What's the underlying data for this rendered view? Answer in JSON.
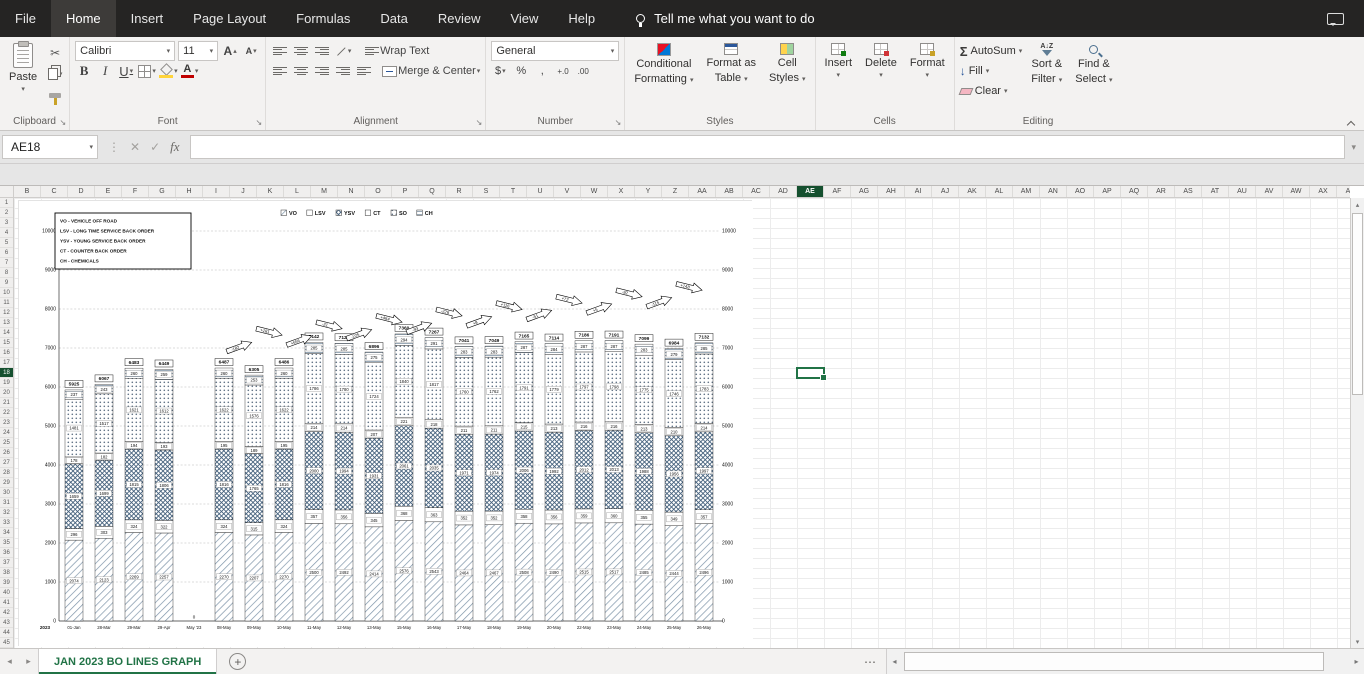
{
  "colors": {
    "excel_green": "#217346",
    "titlebar_bg": "#252423",
    "ribbon_bg": "#f3f2f1",
    "selection_border": "#217346",
    "selected_header_bg": "#15502f"
  },
  "titlebar": {
    "tabs": [
      "File",
      "Home",
      "Insert",
      "Page Layout",
      "Formulas",
      "Data",
      "Review",
      "View",
      "Help"
    ],
    "active_tab": "Home",
    "tellme": "Tell me what you want to do"
  },
  "ribbon": {
    "clipboard": {
      "paste": "Paste",
      "label": "Clipboard"
    },
    "font": {
      "name": "Calibri",
      "size": "11",
      "bold": "B",
      "italic": "I",
      "underline": "U",
      "label": "Font"
    },
    "alignment": {
      "wrap_text": "Wrap Text",
      "merge_center": "Merge & Center",
      "label": "Alignment"
    },
    "number": {
      "format": "General",
      "currency": "$",
      "percent": "%",
      "comma": ",",
      "inc_decimal": "+.0",
      "dec_decimal": ".00",
      "label": "Number"
    },
    "styles": {
      "conditional_1": "Conditional",
      "conditional_2": "Formatting",
      "format_table_1": "Format as",
      "format_table_2": "Table",
      "cell_styles_1": "Cell",
      "cell_styles_2": "Styles",
      "label": "Styles"
    },
    "cells": {
      "insert": "Insert",
      "del": "Delete",
      "format": "Format",
      "label": "Cells"
    },
    "editing": {
      "autosum": "AutoSum",
      "fill": "Fill",
      "clear": "Clear",
      "sort_1": "Sort &",
      "sort_2": "Filter",
      "find_1": "Find &",
      "find_2": "Select",
      "label": "Editing"
    }
  },
  "formula_bar": {
    "name_box": "AE18",
    "fx_label": "fx",
    "value": ""
  },
  "grid": {
    "columns": [
      "B",
      "C",
      "D",
      "E",
      "F",
      "G",
      "H",
      "I",
      "J",
      "K",
      "L",
      "M",
      "N",
      "O",
      "P",
      "Q",
      "R",
      "S",
      "T",
      "U",
      "V",
      "W",
      "X",
      "Y",
      "Z",
      "AA",
      "AB",
      "AC",
      "AD",
      "AE",
      "AF",
      "AG",
      "AH",
      "AI",
      "AJ",
      "AK",
      "AL",
      "AM",
      "AN",
      "AO",
      "AP",
      "AQ",
      "AR",
      "AS",
      "AT",
      "AU",
      "AV",
      "AW",
      "AX",
      "AY"
    ],
    "rows": 45,
    "selected": {
      "ref": "AE18",
      "col": "AE",
      "row": 18
    }
  },
  "sheet_tabs": {
    "active": "JAN 2023 BO LINES GRAPH"
  },
  "chart_data": {
    "type": "bar",
    "stacked": true,
    "legend": [
      "VO",
      "LSV",
      "YSV",
      "CT",
      "SO",
      "CH"
    ],
    "legend_position": "top",
    "key_box_lines": [
      "VO - VEHICLE OFF ROAD",
      "LSV - LONG TIME SERVICE BACK ORDER",
      "YSV - YOUNG SERVICE BACK ORDER",
      "CT - COUNTER BACK ORDER",
      "CH - CHEMICALS"
    ],
    "year_label": "2023",
    "categories": [
      "01-Jan",
      "28-Mar",
      "29-Mar",
      "29-Apr",
      "May '23",
      "08-May",
      "09-May",
      "10-May",
      "11-May",
      "12-May",
      "13-May",
      "15-May",
      "16-May",
      "17-May",
      "18-May",
      "19-May",
      "20-May",
      "22-May",
      "23-May",
      "24-May",
      "25-May",
      "26-May"
    ],
    "series": [
      {
        "name": "VO",
        "pattern": "diagonal",
        "values": [
          2074,
          2123,
          2269,
          2257,
          0,
          2270,
          2207,
          2270,
          2500,
          2492,
          2414,
          2576,
          2543,
          2464,
          2467,
          2508,
          2490,
          2515,
          2517,
          2485,
          2444,
          2496
        ]
      },
      {
        "name": "LSV",
        "pattern": "plain",
        "values": [
          296,
          303,
          324,
          322,
          0,
          324,
          315,
          324,
          357,
          356,
          345,
          368,
          363,
          352,
          352,
          358,
          356,
          359,
          360,
          355,
          349,
          357
        ]
      },
      {
        "name": "YSV",
        "pattern": "crosshatch",
        "values": [
          1659,
          1699,
          1815,
          1806,
          0,
          1816,
          1765,
          1816,
          2000,
          1994,
          1931,
          2061,
          2035,
          1971,
          1974,
          2006,
          1992,
          2012,
          2013,
          1988,
          1956,
          1997
        ]
      },
      {
        "name": "CT",
        "pattern": "plain",
        "values": [
          178,
          182,
          194,
          193,
          0,
          195,
          189,
          195,
          214,
          214,
          207,
          221,
          218,
          211,
          211,
          215,
          213,
          216,
          216,
          213,
          210,
          214
        ]
      },
      {
        "name": "SO",
        "pattern": "dots",
        "values": [
          1481,
          1517,
          1621,
          1612,
          0,
          1622,
          1576,
          1622,
          1786,
          1780,
          1724,
          1840,
          1817,
          1760,
          1762,
          1791,
          1779,
          1797,
          1798,
          1775,
          1746,
          1783
        ]
      },
      {
        "name": "CH",
        "pattern": "hlines",
        "values": [
          237,
          243,
          260,
          259,
          0,
          260,
          253,
          260,
          285,
          285,
          275,
          294,
          291,
          283,
          283,
          287,
          284,
          287,
          287,
          283,
          279,
          285
        ]
      }
    ],
    "totals": [
      5925,
      6067,
      6483,
      6449,
      0,
      6487,
      6305,
      6486,
      7142,
      7121,
      6896,
      7360,
      7267,
      7041,
      7049,
      7165,
      7114,
      7186,
      7191,
      7099,
      6984,
      7132
    ],
    "change_arrows": {
      "start_index": 5,
      "labels": [
        "-182",
        "+181",
        "+656",
        "-21",
        "-225",
        "+464",
        "-93",
        "-226",
        "+8",
        "+116",
        "-51",
        "+72",
        "+5",
        "-92",
        "-115",
        "+148"
      ]
    },
    "ylim": [
      0,
      10000
    ],
    "ytick": 1000,
    "grid": "dashed",
    "axis_labels_both_sides": true
  }
}
